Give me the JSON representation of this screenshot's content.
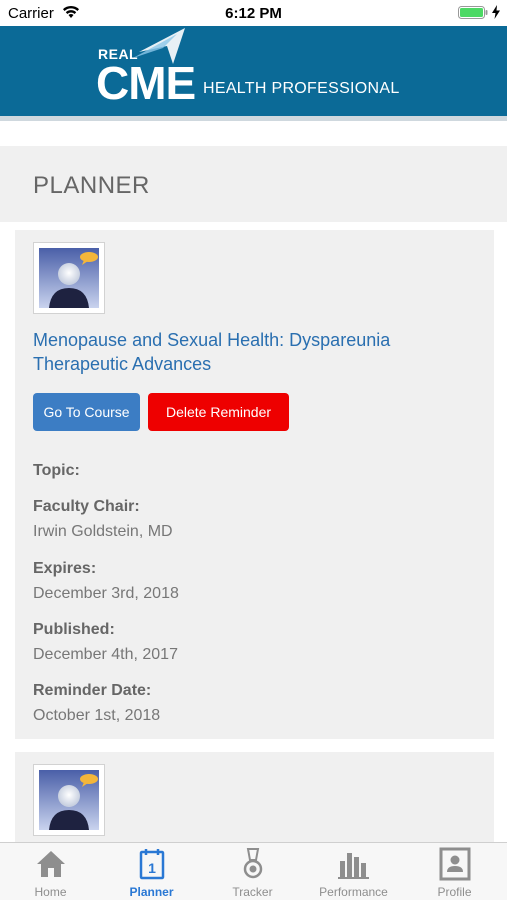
{
  "status_bar": {
    "carrier": "Carrier",
    "time": "6:12 PM"
  },
  "header": {
    "logo_small": "REAL",
    "logo_big": "CME",
    "subtitle": "HEALTH PROFESSIONAL"
  },
  "page": {
    "title": "PLANNER"
  },
  "courses": [
    {
      "title": "Menopause and Sexual Health: Dyspareunia Therapeutic Advances",
      "go_button": "Go To Course",
      "delete_button": "Delete Reminder",
      "fields": {
        "topic_label": "Topic:",
        "faculty_label": "Faculty Chair:",
        "faculty_value": "Irwin Goldstein, MD",
        "expires_label": "Expires:",
        "expires_value": "December 3rd, 2018",
        "published_label": "Published:",
        "published_value": "December 4th, 2017",
        "reminder_label": "Reminder Date:",
        "reminder_value": "October 1st, 2018"
      }
    }
  ],
  "tab_bar": {
    "items": [
      {
        "label": "Home",
        "icon": "home-icon"
      },
      {
        "label": "Planner",
        "icon": "calendar-icon",
        "badge": "1"
      },
      {
        "label": "Tracker",
        "icon": "medal-icon"
      },
      {
        "label": "Performance",
        "icon": "bar-chart-icon"
      },
      {
        "label": "Profile",
        "icon": "profile-card-icon"
      }
    ],
    "active_index": 1
  },
  "colors": {
    "header": "#0b6a97",
    "link": "#2a6fb0",
    "go_button": "#3c7dc4",
    "delete_button": "#ee0000",
    "tab_active": "#2a78d4"
  }
}
